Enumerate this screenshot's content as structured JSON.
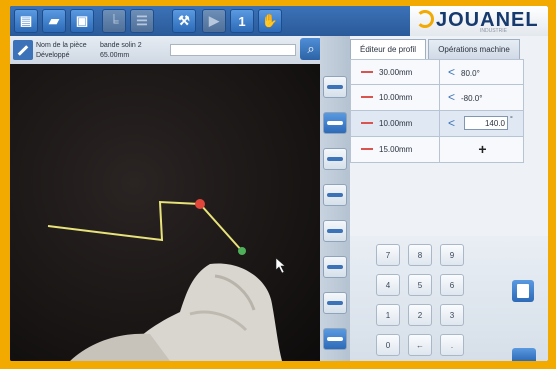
{
  "brand": {
    "name": "JOUANEL",
    "tagline": "INDUSTRIE"
  },
  "toolbar": {
    "play_glyph": "▶",
    "step_glyph": "1",
    "tools_glyph": "⚒",
    "search_glyph": "⌕"
  },
  "info": {
    "part_name_label": "Nom de la pièce",
    "part_name_value": "bande solin 2",
    "developed_label": "Développé",
    "developed_value": "65.00mm"
  },
  "tabs": [
    {
      "label": "Éditeur de profil",
      "active": true
    },
    {
      "label": "Opérations machine",
      "active": false
    }
  ],
  "profile_rows": [
    {
      "length": "30.00mm",
      "angle": "80.0°"
    },
    {
      "length": "10.00mm",
      "angle": "-80.0°"
    },
    {
      "length": "10.00mm",
      "angle": "140.0",
      "angle_unit": "°"
    },
    {
      "length": "15.00mm",
      "angle": ""
    }
  ],
  "add_label": "+",
  "keypad": [
    "7",
    "8",
    "9",
    "4",
    "5",
    "6",
    "1",
    "2",
    "3",
    "0",
    "←",
    "."
  ],
  "colors": {
    "accent": "#2d6ab8",
    "frame": "#f2a900",
    "profile_line": "#e8e27a",
    "bend_point": "#e0463a",
    "end_point": "#4fb05a"
  }
}
